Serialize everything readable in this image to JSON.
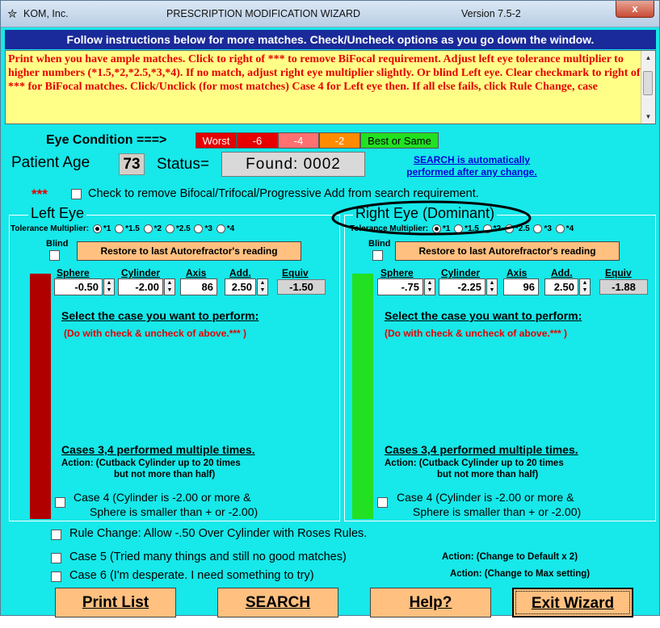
{
  "titlebar": {
    "company": "KOM, Inc.",
    "title": "PRESCRIPTION MODIFICATION WIZARD",
    "version": "Version 7.5-2",
    "close": "x"
  },
  "instructions": {
    "header": "Follow instructions below for more matches. Check/Uncheck options as you go down the window.",
    "text": "Print when you have ample matches. Click to right of *** to remove BiFocal requirement. Adjust left eye tolerance multiplier to higher numbers (*1.5,*2,*2.5,*3,*4). If no match, adjust right eye multiplier slightly.  Or blind Left eye. Clear checkmark to right of *** for BiFocal matches. Click/Unclick (for most matches) Case 4 for Left eye then. If all else fails, click Rule Change, case"
  },
  "eye_condition": {
    "label": "Eye Condition ===>",
    "levels": [
      {
        "label": "Worst",
        "color": "#e60000"
      },
      {
        "label": "-6",
        "color": "#e60000"
      },
      {
        "label": "-4",
        "color": "#ff7070"
      },
      {
        "label": "-2",
        "color": "#ff8c00"
      },
      {
        "label": "Best or Same",
        "color": "#22e022"
      }
    ]
  },
  "patient": {
    "age_label": "Patient Age",
    "age": "73",
    "status_label": "Status=",
    "status": "Found:  0002",
    "search_note_1": "SEARCH is automatically",
    "search_note_2": "performed after any change."
  },
  "bifocal": {
    "stars": "***",
    "label": "Check to remove Bifocal/Trifocal/Progressive Add from search requirement.",
    "checked": false
  },
  "left_eye": {
    "title": "Left Eye",
    "tolerance_label": "Tolerance Multiplier:",
    "multipliers": [
      "*1",
      "*1.5",
      "*2",
      "*2.5",
      "*3",
      "*4"
    ],
    "selected_multiplier": "*1",
    "blind_label": "Blind",
    "restore_label": "Restore to last Autorefractor's reading",
    "bar_color": "#b00000",
    "headers": {
      "sphere": "Sphere",
      "cylinder": "Cylinder",
      "axis": "Axis",
      "add": "Add.",
      "equiv": "Equiv"
    },
    "sphere": "-0.50",
    "cylinder": "-2.00",
    "axis": "86",
    "add": "2.50",
    "equiv": "-1.50",
    "select_case": "Select the case you want to perform:",
    "do_with": "(Do with check & uncheck of above.*** )",
    "cases_title": "Cases 3,4 performed multiple times.",
    "action_1": "Action:  (Cutback Cylinder up to 20 times",
    "action_2": "but not more than half)",
    "case4_1": "Case 4 (Cylinder is -2.00 or more &",
    "case4_2": "Sphere is smaller than + or -2.00)"
  },
  "right_eye": {
    "title": "Right Eye (Dominant)",
    "tolerance_label": "Tolerance Multiplier:",
    "multipliers": [
      "*1",
      "*1.5",
      "*2",
      "*2.5",
      "*3",
      "*4"
    ],
    "selected_multiplier": "*1",
    "blind_label": "Blind",
    "restore_label": "Restore to last Autorefractor's reading",
    "bar_color": "#22e022",
    "headers": {
      "sphere": "Sphere",
      "cylinder": "Cylinder",
      "axis": "Axis",
      "add": "Add.",
      "equiv": "Equiv"
    },
    "sphere": "-.75",
    "cylinder": "-2.25",
    "axis": "96",
    "add": "2.50",
    "equiv": "-1.88",
    "select_case": "Select the case you want to perform:",
    "do_with": "(Do with check & uncheck of above.*** )",
    "cases_title": "Cases 3,4 performed multiple times.",
    "action_1": "Action:  (Cutback Cylinder up to 20 times",
    "action_2": "but not more than half)",
    "case4_1": "Case 4 (Cylinder is -2.00 or more &",
    "case4_2": "Sphere is smaller than + or -2.00)"
  },
  "options": {
    "rule_change": "Rule Change: Allow -.50 Over Cylinder with Roses Rules.",
    "case5": "Case 5 (Tried many things and still no good matches)",
    "case5_action": "Action:  (Change to Default x 2)",
    "case6": "Case 6 (I'm desperate.  I need something to try)",
    "case6_action": "Action:  (Change to Max setting)"
  },
  "buttons": {
    "print": "Print List",
    "search": "SEARCH",
    "help": "Help?",
    "exit": "Exit Wizard"
  },
  "colors": {
    "window_bg": "#17e8e9",
    "button_bg": "#ffc080",
    "instruction_header_bg": "#1a2a9a",
    "instruction_bg": "#ffff88",
    "instruction_text": "#e60000"
  }
}
